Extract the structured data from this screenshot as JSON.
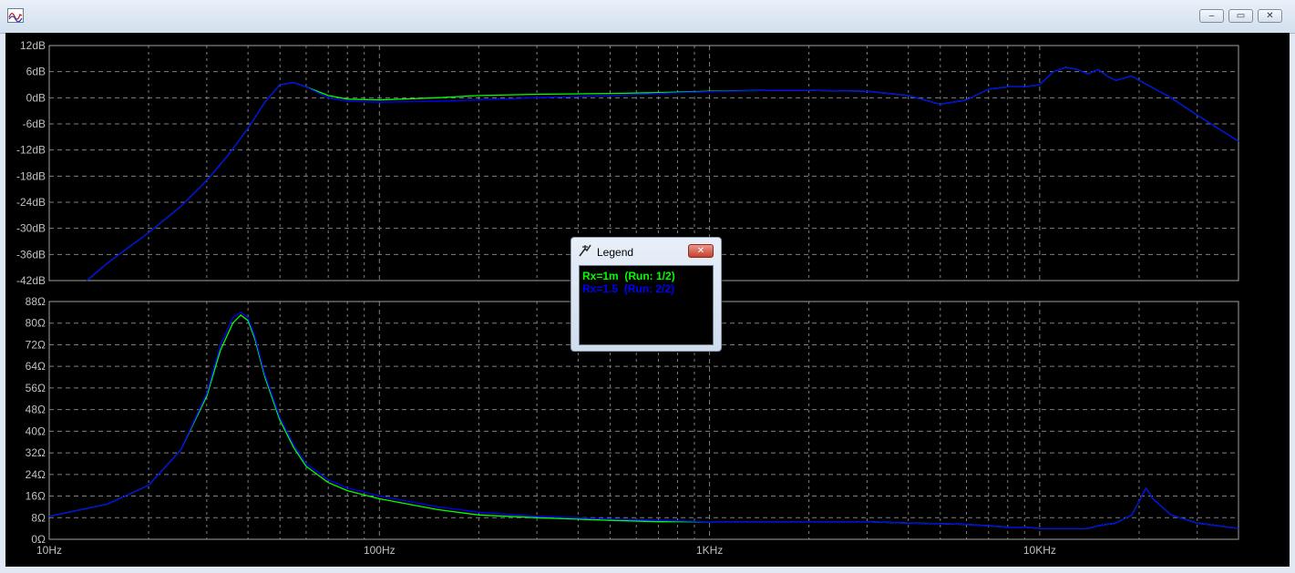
{
  "window": {
    "minimize_symbol": "‒",
    "maximize_symbol": "▭",
    "close_symbol": "✕"
  },
  "legend": {
    "title": "Legend",
    "close_symbol": "✕",
    "entries": [
      {
        "text": "Rx=1m  (Run: 1/2)",
        "color": "#00ff00"
      },
      {
        "text": "Rx=1.5  (Run: 2/2)",
        "color": "#0000ff"
      }
    ]
  },
  "colors": {
    "background": "#000000",
    "grid": "#808080",
    "axis_text": "#c0c0c0",
    "run1": "#00ff00",
    "run2": "#0000ff"
  },
  "chart_data": [
    {
      "type": "line",
      "x_scale": "log",
      "xlim": [
        10,
        40000
      ],
      "ylim": [
        -42,
        12
      ],
      "yticks": [
        "12dB",
        "6dB",
        "0dB",
        "-6dB",
        "-12dB",
        "-18dB",
        "-24dB",
        "-30dB",
        "-36dB",
        "-42dB"
      ],
      "grid": true,
      "series": [
        {
          "name": "Rx=1m  (Run: 1/2)",
          "color": "#00ff00",
          "x": [
            13,
            15,
            20,
            25,
            30,
            35,
            40,
            45,
            50,
            55,
            60,
            70,
            80,
            100,
            150,
            200,
            300,
            500,
            700,
            1000,
            1500,
            2000,
            3000,
            4000,
            5000,
            6000,
            7000,
            8000,
            9000,
            10000,
            11000,
            12000,
            13000,
            14000,
            15000,
            16000,
            17000,
            18000,
            19000,
            20000,
            25000,
            30000,
            40000
          ],
          "y": [
            -42,
            -38,
            -31,
            -25,
            -19,
            -13,
            -7,
            -1,
            3,
            3.5,
            2.5,
            0.5,
            -0.3,
            -0.5,
            0,
            0.5,
            0.8,
            1,
            1.2,
            1.5,
            1.7,
            1.7,
            1.5,
            0.5,
            -1.5,
            -0.5,
            2,
            2.5,
            2.5,
            3,
            6,
            7,
            6.5,
            5.5,
            6.5,
            5,
            4,
            4.5,
            5,
            4,
            0,
            -4,
            -10
          ]
        },
        {
          "name": "Rx=1.5  (Run: 2/2)",
          "color": "#0000ff",
          "x": [
            13,
            15,
            20,
            25,
            30,
            35,
            40,
            45,
            50,
            55,
            60,
            70,
            80,
            100,
            150,
            200,
            300,
            500,
            700,
            1000,
            1500,
            2000,
            3000,
            4000,
            5000,
            6000,
            7000,
            8000,
            9000,
            10000,
            11000,
            12000,
            13000,
            14000,
            15000,
            16000,
            17000,
            18000,
            19000,
            20000,
            25000,
            30000,
            40000
          ],
          "y": [
            -42,
            -38,
            -31,
            -25,
            -19,
            -13,
            -7,
            -1,
            3,
            3.5,
            2.5,
            0,
            -0.8,
            -1,
            -0.8,
            -0.5,
            0,
            0.5,
            1,
            1.4,
            1.7,
            1.7,
            1.5,
            0.5,
            -1.5,
            -0.5,
            2,
            2.5,
            2.5,
            3,
            6,
            7,
            6.5,
            5.5,
            6.5,
            5,
            4,
            4.5,
            5,
            4,
            0,
            -4,
            -10
          ]
        }
      ]
    },
    {
      "type": "line",
      "x_scale": "log",
      "xlim": [
        10,
        40000
      ],
      "ylim": [
        0,
        88
      ],
      "yticks": [
        "88Ω",
        "80Ω",
        "72Ω",
        "64Ω",
        "56Ω",
        "48Ω",
        "40Ω",
        "32Ω",
        "24Ω",
        "16Ω",
        "8Ω",
        "0Ω"
      ],
      "xticks": [
        {
          "value": 10,
          "label": "10Hz"
        },
        {
          "value": 100,
          "label": "100Hz"
        },
        {
          "value": 1000,
          "label": "1KHz"
        },
        {
          "value": 10000,
          "label": "10KHz"
        }
      ],
      "grid": true,
      "series": [
        {
          "name": "Rx=1m  (Run: 1/2)",
          "color": "#00ff00",
          "x": [
            10,
            15,
            20,
            25,
            30,
            33,
            36,
            38,
            40,
            42,
            45,
            50,
            55,
            60,
            70,
            80,
            100,
            150,
            200,
            300,
            500,
            700,
            1000,
            1500,
            2000,
            3000,
            4000,
            5000,
            6000,
            7000,
            8000,
            9000,
            10000,
            12000,
            14000,
            15000,
            17000,
            19000,
            20000,
            21000,
            22000,
            25000,
            30000,
            40000
          ],
          "y": [
            8.5,
            13,
            20,
            33,
            53,
            70,
            80,
            83,
            81,
            74,
            60,
            44,
            34,
            27,
            21,
            18,
            15,
            11,
            9,
            8,
            7,
            6.5,
            6.5,
            6.5,
            6.5,
            6.5,
            6,
            5.8,
            5.5,
            5,
            4.5,
            4.5,
            4,
            4,
            4,
            5,
            6,
            9,
            14,
            19,
            15,
            9,
            6,
            4
          ]
        },
        {
          "name": "Rx=1.5  (Run: 2/2)",
          "color": "#0000ff",
          "x": [
            10,
            15,
            20,
            25,
            30,
            33,
            36,
            38,
            40,
            42,
            45,
            50,
            55,
            60,
            70,
            80,
            100,
            150,
            200,
            300,
            500,
            700,
            1000,
            1500,
            2000,
            3000,
            4000,
            5000,
            6000,
            7000,
            8000,
            9000,
            10000,
            12000,
            14000,
            15000,
            17000,
            19000,
            20000,
            21000,
            22000,
            25000,
            30000,
            40000
          ],
          "y": [
            8.5,
            13,
            20,
            33,
            54,
            72,
            82,
            84,
            82,
            75,
            61,
            45,
            35,
            28,
            22,
            19,
            16,
            12,
            10,
            8.5,
            7.5,
            7,
            6.5,
            6.5,
            6.5,
            6.5,
            6,
            5.8,
            5.5,
            5,
            4.5,
            4.5,
            4,
            4,
            4,
            5,
            6,
            9,
            14,
            19,
            15,
            9,
            6,
            4
          ]
        }
      ]
    }
  ]
}
